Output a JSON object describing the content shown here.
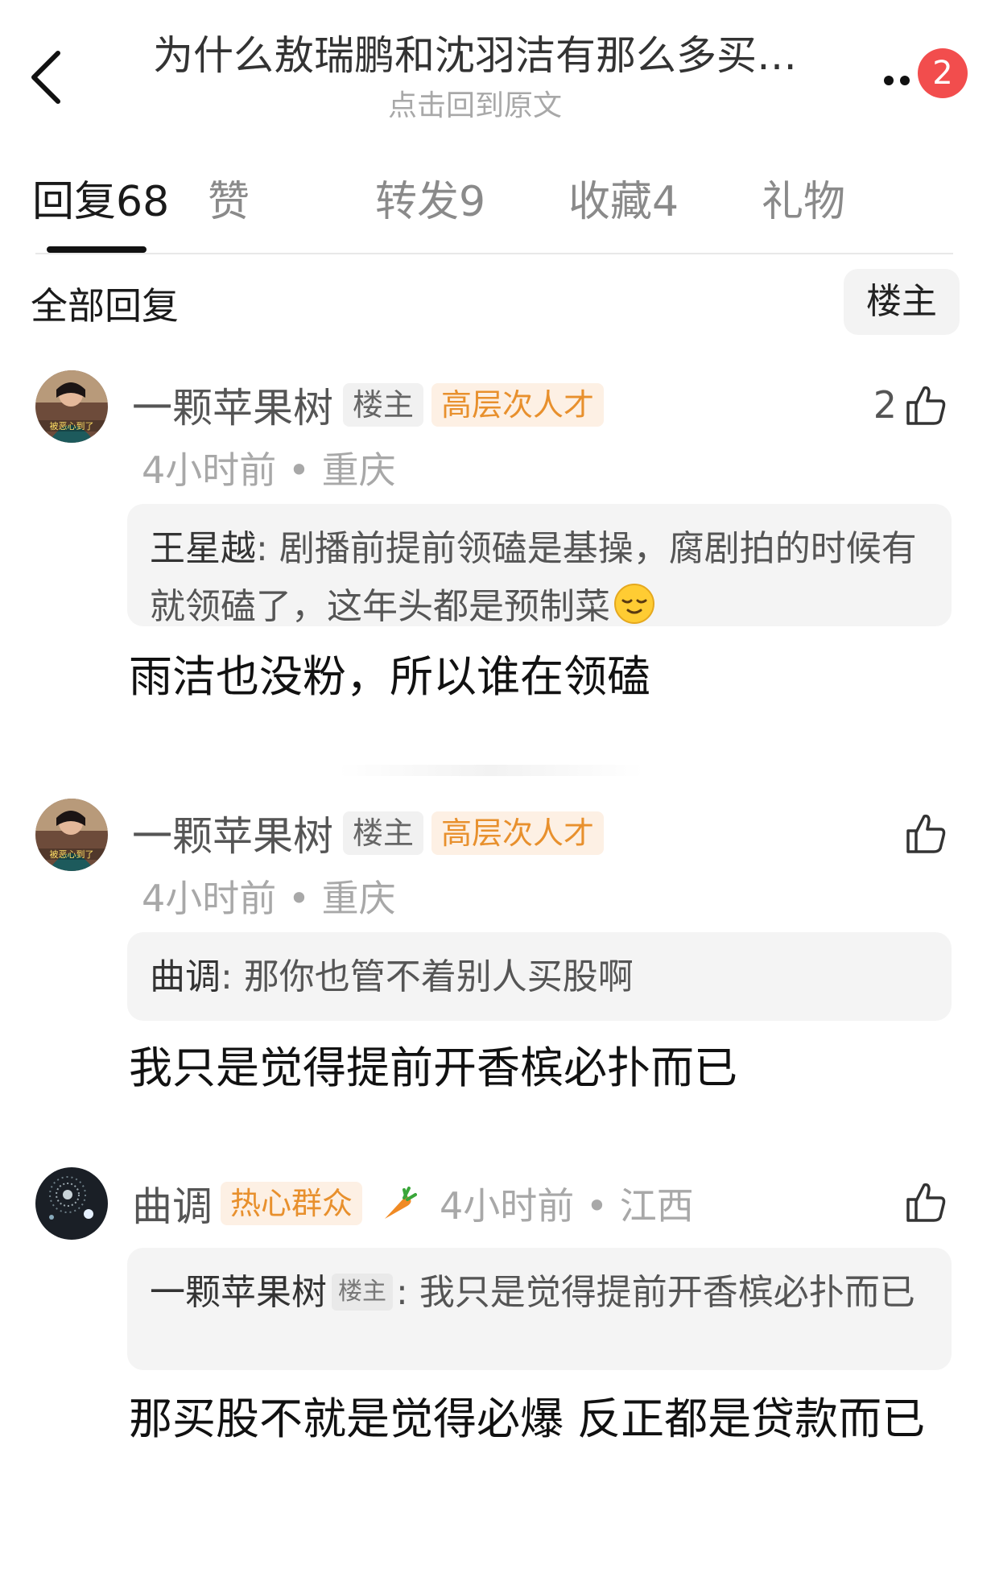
{
  "header": {
    "title": "为什么敖瑞鹏和沈羽洁有那么多买…",
    "subtitle": "点击回到原文",
    "notification_count": "2"
  },
  "tabs": [
    {
      "label": "回复68",
      "active": true
    },
    {
      "label": "赞",
      "active": false
    },
    {
      "label": "转发9",
      "active": false
    },
    {
      "label": "收藏4",
      "active": false
    },
    {
      "label": "礼物",
      "active": false
    }
  ],
  "filter": {
    "label": "全部回复",
    "op_only_label": "楼主"
  },
  "comments": [
    {
      "username": "一颗苹果树",
      "op_tag": "楼主",
      "level_tag": "高层次人才",
      "avatar_caption": "被恶心到了",
      "time": "4小时前",
      "location": "重庆",
      "like_count": "2",
      "quote_author": "王星越",
      "quote_text": "剧播前提前领磕是基操，腐剧拍的时候有就领磕了，这年头都是预制菜",
      "text": "雨洁也没粉，所以谁在领磕"
    },
    {
      "username": "一颗苹果树",
      "op_tag": "楼主",
      "level_tag": "高层次人才",
      "avatar_caption": "被恶心到了",
      "time": "4小时前",
      "location": "重庆",
      "like_count": "",
      "quote_author": "曲调",
      "quote_text": "那你也管不着别人买股啊",
      "text": "我只是觉得提前开香槟必扑而已"
    },
    {
      "username": "曲调",
      "level_tag": "热心群众",
      "time": "4小时前",
      "location": "江西",
      "like_count": "",
      "quote_author": "一颗苹果树",
      "quote_op_tag": "楼主",
      "quote_text": "我只是觉得提前开香槟必扑而已",
      "text": "那买股不就是觉得必爆 反正都是贷款而已"
    }
  ],
  "colors": {
    "badge": "#f24d4d",
    "level_tag_text": "#e8902d",
    "level_tag_bg": "#fdf0e4",
    "meta_text": "#a8a8a8"
  },
  "icons": [
    "back-chevron-icon",
    "more-dots-icon",
    "thumbs-up-icon",
    "carrot-icon",
    "relieved-face-emoji-icon"
  ]
}
